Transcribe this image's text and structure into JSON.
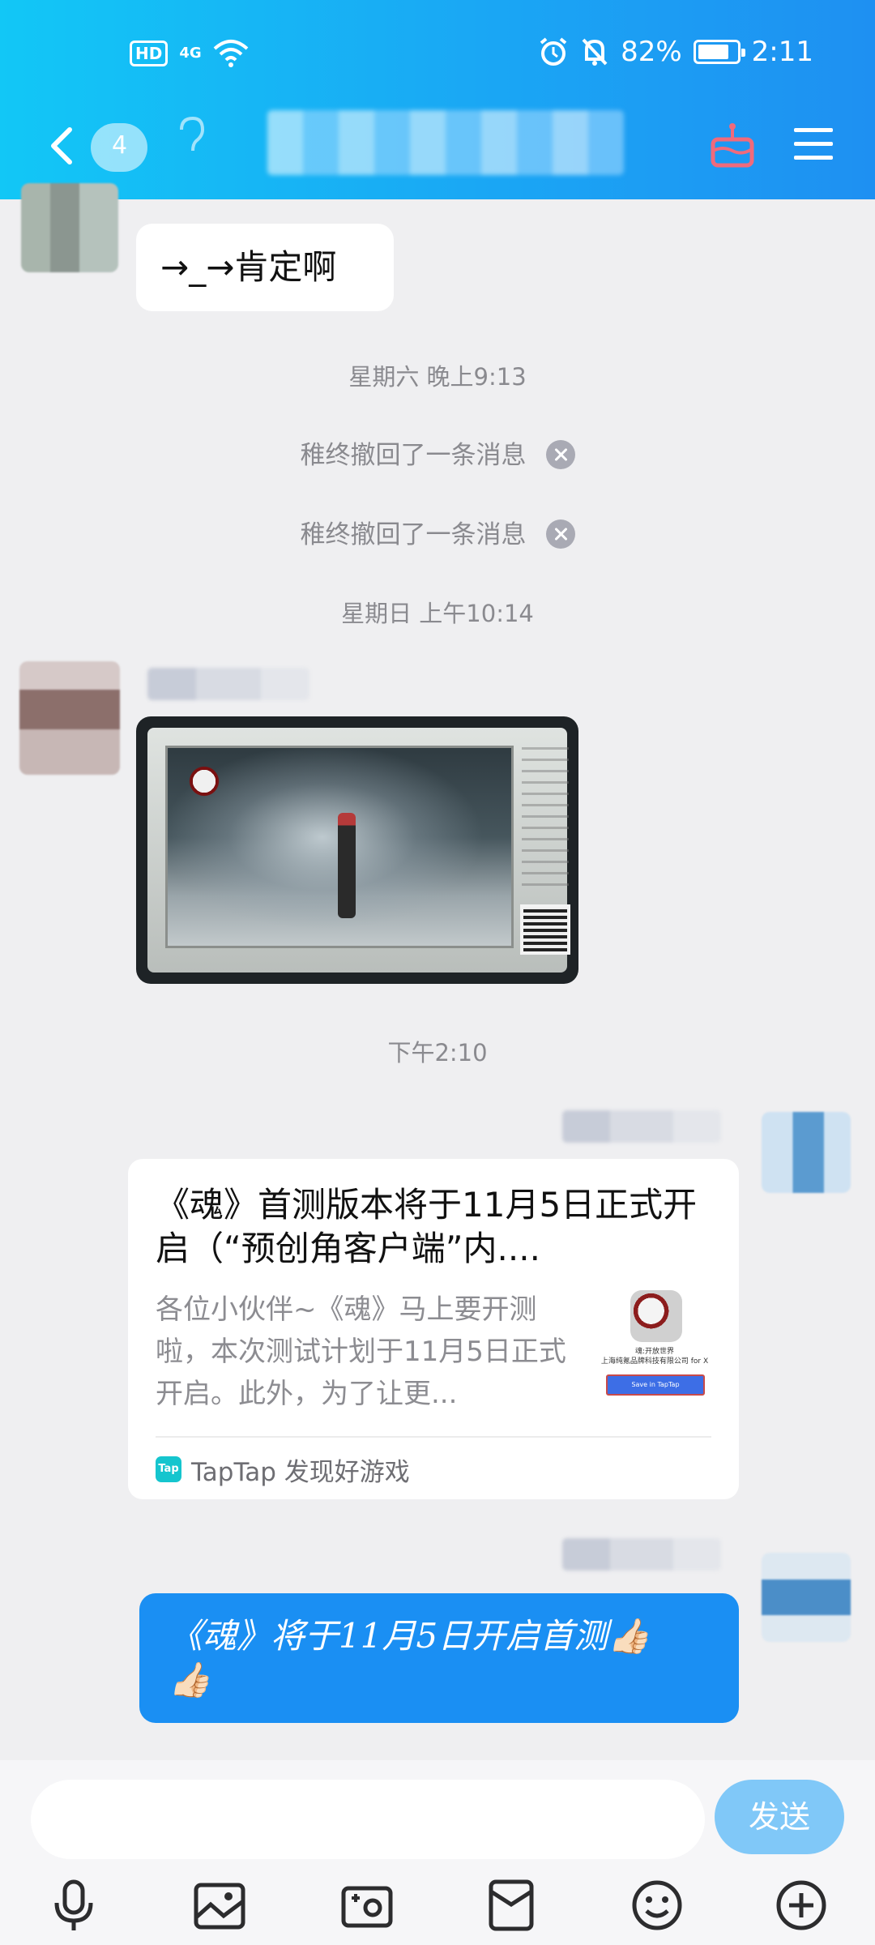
{
  "status_bar": {
    "hd": "HD",
    "network": "4G",
    "battery": "82%",
    "battery_level": 0.82,
    "time": "2:11"
  },
  "nav": {
    "avatar_badge": "4"
  },
  "messages": {
    "first_bubble": "→_→肯定啊",
    "ts_saturday": "星期六 晚上9:13",
    "recall_1": "稚终撤回了一条消息",
    "recall_2": "稚终撤回了一条消息",
    "ts_sunday": "星期日 上午10:14",
    "ts_today": "下午2:10",
    "link_card": {
      "title": "《魂》首测版本将于11月5日正式开启（“预创角客户端”内....",
      "description": "各位小伙伴~《魂》马上要开测啦，本次测试计划于11月5日正式开启。此外，为了让更...",
      "thumb_line1": "魂:开放世界",
      "thumb_line2": "上海纯氪品牌科技有限公司 for X",
      "thumb_button": "Save in TapTap",
      "source_icon": "Tap",
      "source": "TapTap 发现好游戏"
    },
    "last_bubble": "《魂》将于11月5日开启首测👍🏻\n👍🏻"
  },
  "input": {
    "send_label": "发送"
  },
  "toolbar": {
    "items": [
      "microphone-icon",
      "picture-icon",
      "camera-icon",
      "red-packet-icon",
      "emoji-icon",
      "plus-icon"
    ]
  },
  "colors": {
    "header_start": "#12c7f6",
    "header_end": "#1e90f2",
    "outgoing_bubble": "#1a8ff3",
    "send_button": "#80c8f8",
    "background": "#efeff1"
  }
}
